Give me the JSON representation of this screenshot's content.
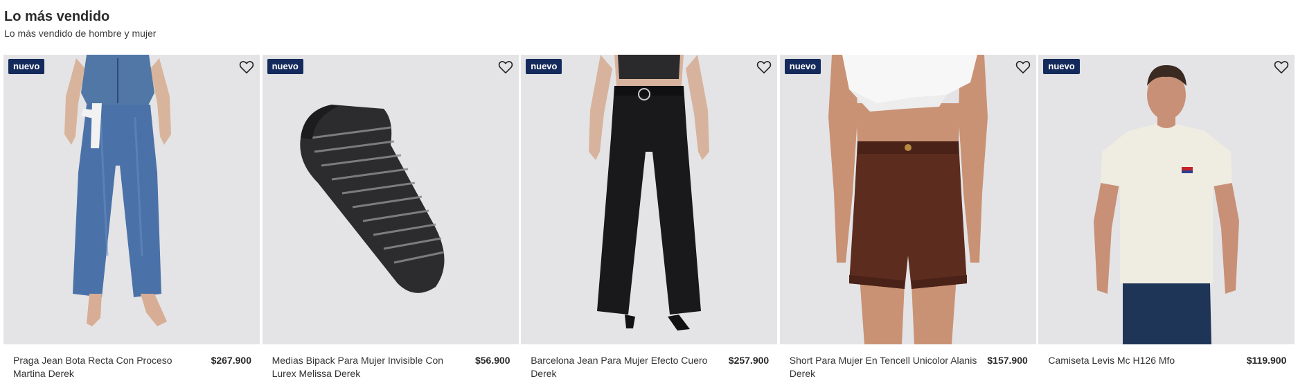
{
  "section": {
    "title": "Lo más vendido",
    "subtitle": "Lo más vendido de hombre y mujer"
  },
  "colors": {
    "badge": "#152a5c",
    "image_bg": "#e3e3e3"
  },
  "products": [
    {
      "badge": "nuevo",
      "name": "Praga Jean Bota Recta Con Proceso Martina Derek",
      "price": "$267.900",
      "image": "jeans-woman",
      "favorite_icon": "heart-outline-icon"
    },
    {
      "badge": "nuevo",
      "name": "Medias Bipack Para Mujer Invisible Con Lurex Melissa Derek",
      "price": "$56.900",
      "image": "striped-sock",
      "favorite_icon": "heart-outline-icon"
    },
    {
      "badge": "nuevo",
      "name": "Barcelona Jean Para Mujer Efecto Cuero Derek",
      "price": "$257.900",
      "image": "black-wide-pants",
      "favorite_icon": "heart-outline-icon"
    },
    {
      "badge": "nuevo",
      "name": "Short Para Mujer En Tencell Unicolor Alanis Derek",
      "price": "$157.900",
      "image": "brown-shorts",
      "favorite_icon": "heart-outline-icon"
    },
    {
      "badge": "nuevo",
      "name": "Camiseta Levis Mc H126 Mfo",
      "price": "$119.900",
      "image": "man-white-tshirt",
      "favorite_icon": "heart-outline-icon"
    }
  ]
}
